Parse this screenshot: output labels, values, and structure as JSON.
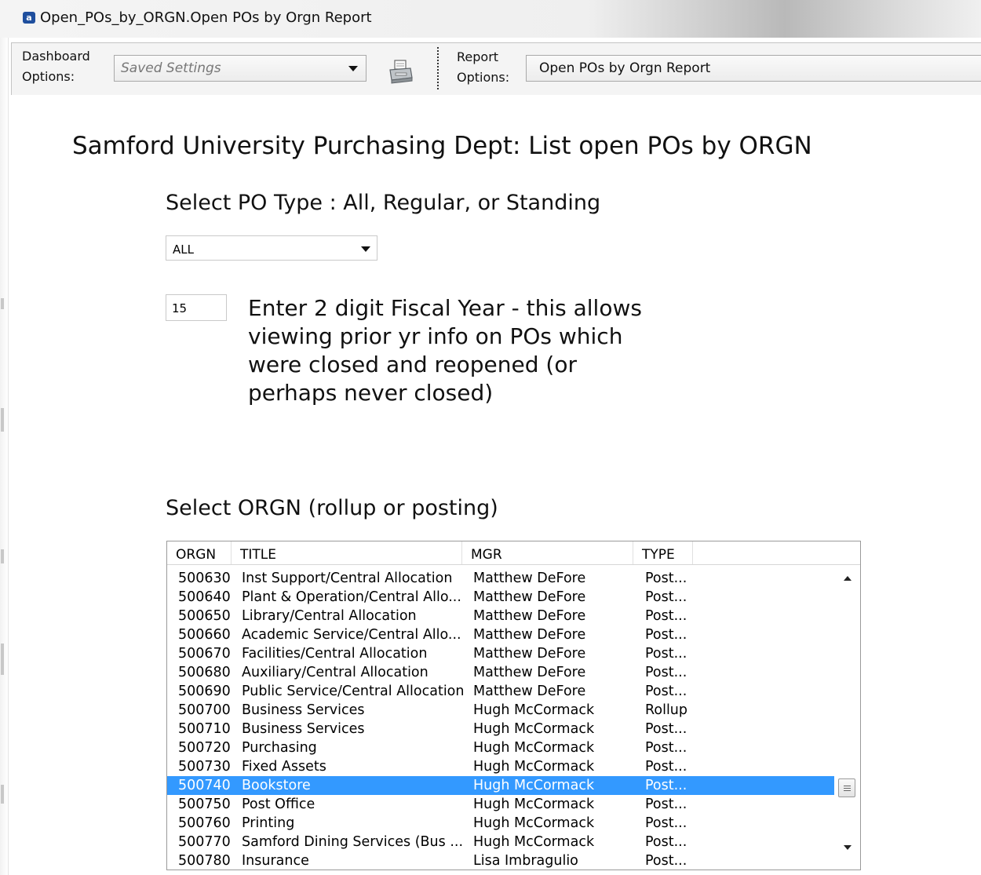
{
  "window": {
    "title": "Open_POs_by_ORGN.Open POs by Orgn Report",
    "icon": "app-icon"
  },
  "toolbar": {
    "dashboard_label_1": "Dashboard",
    "dashboard_label_2": "Options:",
    "saved_settings_value": "Saved Settings",
    "report_label_1": "Report",
    "report_label_2": "Options:",
    "report_value": "Open POs by Orgn Report",
    "print_icon": "printer-icon"
  },
  "main": {
    "heading": "Samford University Purchasing Dept:  List open POs by ORGN",
    "po_type_label": "Select PO Type :  All, Regular, or Standing",
    "po_type_value": "ALL",
    "fiscal_year_value": "15",
    "fiscal_year_text": "Enter 2 digit Fiscal Year - this allows viewing prior yr info on POs which were closed and reopened (or perhaps never closed)",
    "orgn_label": "Select ORGN (rollup or posting)"
  },
  "orgn_list": {
    "columns": [
      "ORGN",
      "TITLE",
      "MGR",
      "TYPE"
    ],
    "selected_orgn": "500740",
    "rows": [
      {
        "orgn": "500630",
        "title": "Inst Support/Central Allocation",
        "mgr": "Matthew DeFore",
        "type": "Post..."
      },
      {
        "orgn": "500640",
        "title": "Plant & Operation/Central Allo...",
        "mgr": "Matthew DeFore",
        "type": "Post..."
      },
      {
        "orgn": "500650",
        "title": "Library/Central Allocation",
        "mgr": "Matthew DeFore",
        "type": "Post..."
      },
      {
        "orgn": "500660",
        "title": "Academic Service/Central Allo...",
        "mgr": "Matthew DeFore",
        "type": "Post..."
      },
      {
        "orgn": "500670",
        "title": "Facilities/Central Allocation",
        "mgr": "Matthew DeFore",
        "type": "Post..."
      },
      {
        "orgn": "500680",
        "title": "Auxiliary/Central Allocation",
        "mgr": "Matthew DeFore",
        "type": "Post..."
      },
      {
        "orgn": "500690",
        "title": "Public Service/Central Allocation",
        "mgr": "Matthew DeFore",
        "type": "Post..."
      },
      {
        "orgn": "500700",
        "title": "Business Services",
        "mgr": "Hugh McCormack",
        "type": "Rollup"
      },
      {
        "orgn": "500710",
        "title": "Business Services",
        "mgr": "Hugh McCormack",
        "type": "Post..."
      },
      {
        "orgn": "500720",
        "title": "Purchasing",
        "mgr": "Hugh McCormack",
        "type": "Post..."
      },
      {
        "orgn": "500730",
        "title": "Fixed Assets",
        "mgr": "Hugh McCormack",
        "type": "Post..."
      },
      {
        "orgn": "500740",
        "title": "Bookstore",
        "mgr": "Hugh McCormack",
        "type": "Post..."
      },
      {
        "orgn": "500750",
        "title": "Post Office",
        "mgr": "Hugh McCormack",
        "type": "Post..."
      },
      {
        "orgn": "500760",
        "title": "Printing",
        "mgr": "Hugh McCormack",
        "type": "Post..."
      },
      {
        "orgn": "500770",
        "title": "Samford Dining Services (Bus ...",
        "mgr": "Hugh McCormack",
        "type": "Post..."
      },
      {
        "orgn": "500780",
        "title": "Insurance",
        "mgr": "Lisa Imbragulio",
        "type": "Post..."
      }
    ]
  },
  "colors": {
    "selection": "#3399ff",
    "toolbar_bg": "#f4f4f4",
    "app_icon": "#1f4f9e"
  }
}
